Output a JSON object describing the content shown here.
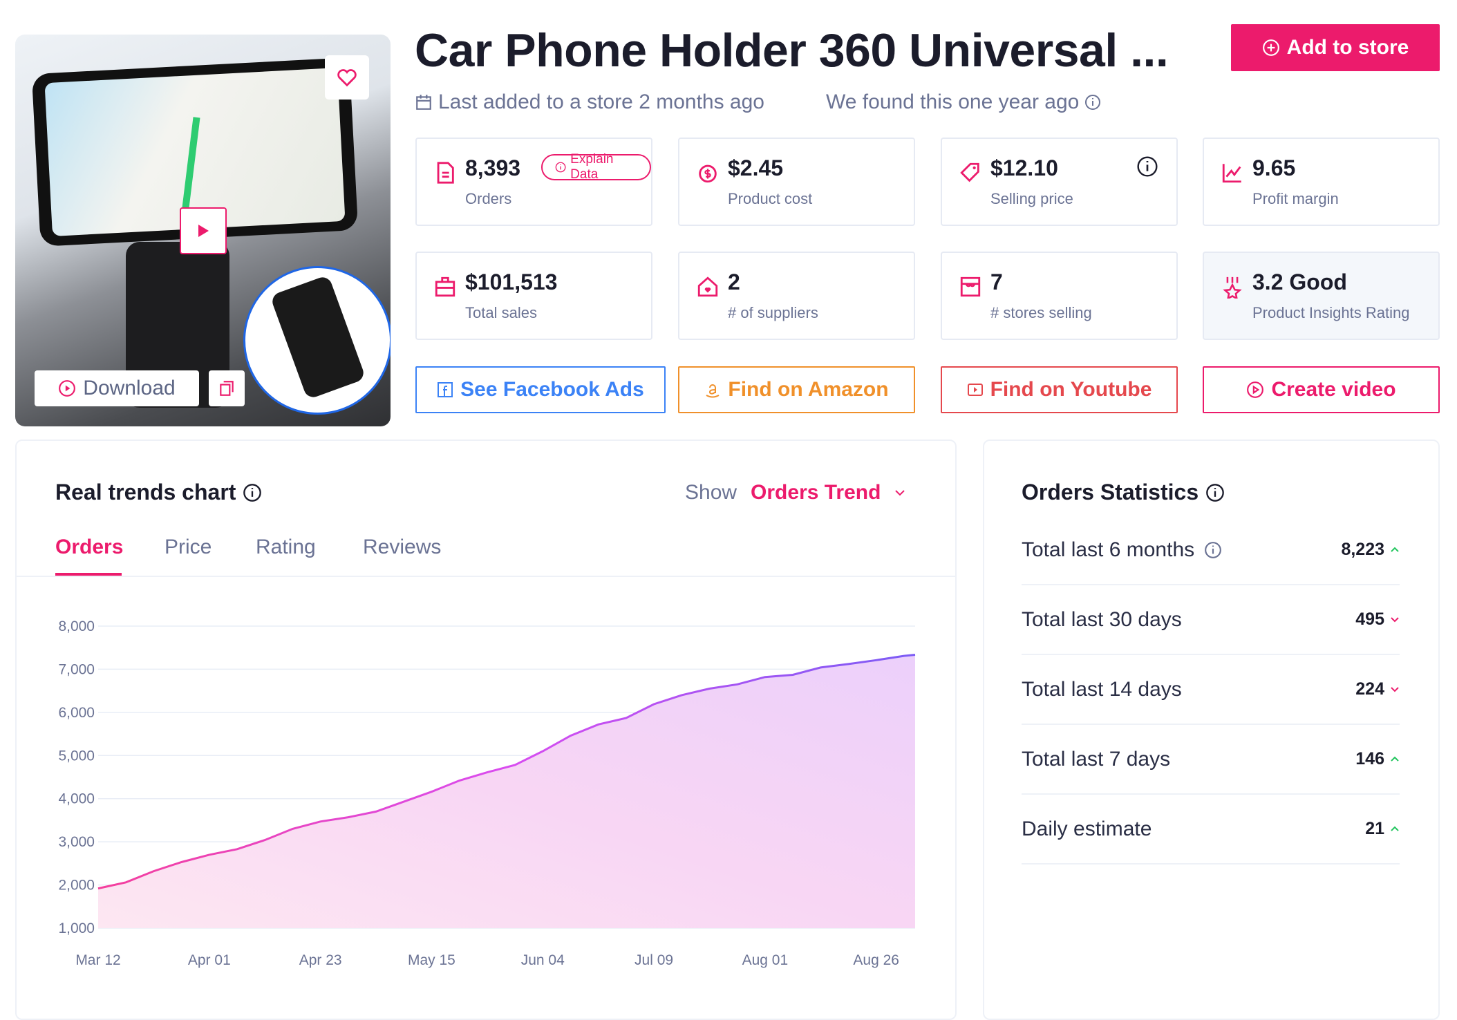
{
  "product": {
    "title": "Car Phone Holder 360 Universal ...",
    "last_added": "Last added to a store 2 months ago",
    "found": "We found this one year ago",
    "download_label": "Download"
  },
  "header": {
    "add_to_store_label": "Add to store"
  },
  "stats_cards": [
    {
      "value": "8,393",
      "label": "Orders",
      "icon": "document-icon",
      "badge": "Explain Data"
    },
    {
      "value": "$2.45",
      "label": "Product cost",
      "icon": "coins-icon"
    },
    {
      "value": "$12.10",
      "label": "Selling price",
      "icon": "tag-icon"
    },
    {
      "value": "9.65",
      "label": "Profit margin",
      "icon": "chart-line-icon"
    },
    {
      "value": "$101,513",
      "label": "Total sales",
      "icon": "briefcase-icon"
    },
    {
      "value": "2",
      "label": "# of suppliers",
      "icon": "house-heart-icon"
    },
    {
      "value": "7",
      "label": "# stores selling",
      "icon": "store-icon"
    },
    {
      "value": "3.2 Good",
      "label": "Product Insights Rating",
      "icon": "award-icon"
    }
  ],
  "actions": [
    {
      "label": "See Facebook Ads",
      "color": "#3b82f6"
    },
    {
      "label": "Find on Amazon",
      "color": "#f0902a"
    },
    {
      "label": "Find on Youtube",
      "color": "#e5484d"
    },
    {
      "label": "Create video",
      "color": "#ec1b6c"
    }
  ],
  "trends": {
    "title": "Real trends chart",
    "show_label": "Show",
    "show_value": "Orders Trend",
    "tabs": [
      "Orders",
      "Price",
      "Rating",
      "Reviews"
    ],
    "active_tab": "Orders"
  },
  "chart_data": {
    "type": "area",
    "ylim": [
      1000,
      8000
    ],
    "yticks": [
      "8,000",
      "7,000",
      "6,000",
      "5,000",
      "4,000",
      "3,000",
      "2,000",
      "1,000"
    ],
    "ytick_values": [
      8000,
      7000,
      6000,
      5000,
      4000,
      3000,
      2000,
      1000
    ],
    "xtick_labels": [
      "Mar 12",
      "Apr 01",
      "Apr 23",
      "May 15",
      "Jun 04",
      "Jul 09",
      "Aug 01",
      "Aug 26"
    ],
    "values": [
      1920,
      2060,
      2320,
      2530,
      2700,
      2830,
      3040,
      3300,
      3470,
      3570,
      3700,
      3930,
      4160,
      4420,
      4610,
      4780,
      5100,
      5460,
      5720,
      5870,
      6190,
      6400,
      6550,
      6650,
      6820,
      6870,
      7040,
      7120,
      7210,
      7310
    ],
    "grid": true,
    "colors": {
      "line_start": "#f43f9c",
      "line_end": "#7b5cf5"
    }
  },
  "orders_statistics": {
    "title": "Orders Statistics",
    "rows": [
      {
        "label": "Total last 6 months",
        "value": "8,223",
        "trend": "up",
        "info": true
      },
      {
        "label": "Total last 30 days",
        "value": "495",
        "trend": "down"
      },
      {
        "label": "Total last 14 days",
        "value": "224",
        "trend": "down"
      },
      {
        "label": "Total last 7 days",
        "value": "146",
        "trend": "up"
      },
      {
        "label": "Daily estimate",
        "value": "21",
        "trend": "up"
      }
    ],
    "colors": {
      "up": "#22c55e",
      "down": "#ec1b6c"
    }
  }
}
